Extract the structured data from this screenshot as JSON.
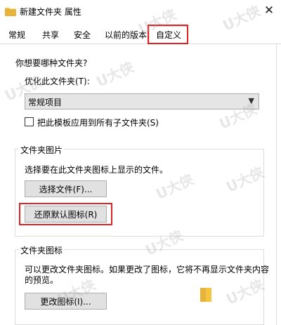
{
  "window": {
    "title": "新建文件夹 属性",
    "close_glyph": "✕"
  },
  "tabs": [
    {
      "label": "常规"
    },
    {
      "label": "共享"
    },
    {
      "label": "安全"
    },
    {
      "label": "以前的版本"
    },
    {
      "label": "自定义",
      "active": true
    }
  ],
  "optimize": {
    "question": "你想要哪种文件夹?",
    "label": "优化此文件夹(T):",
    "selected": "常规项目",
    "checkbox_label": "把此模板应用到所有子文件夹(S)",
    "checkbox_checked": false
  },
  "folder_pictures": {
    "group_title": "文件夹图片",
    "description": "选择要在此文件夹图标上显示的文件。",
    "choose_button": "选择文件(F)...",
    "restore_button": "还原默认图标(R)"
  },
  "folder_icons": {
    "group_title": "文件夹图标",
    "description_line1": "可以更改文件夹图标。如果更改了图标，它将不再显示文件夹内容",
    "description_line2": "的预览。",
    "change_button": "更改图标(I)..."
  },
  "watermark": {
    "text": "U大侠"
  },
  "colors": {
    "highlight": "#e02424",
    "folder": "#f5c542"
  }
}
